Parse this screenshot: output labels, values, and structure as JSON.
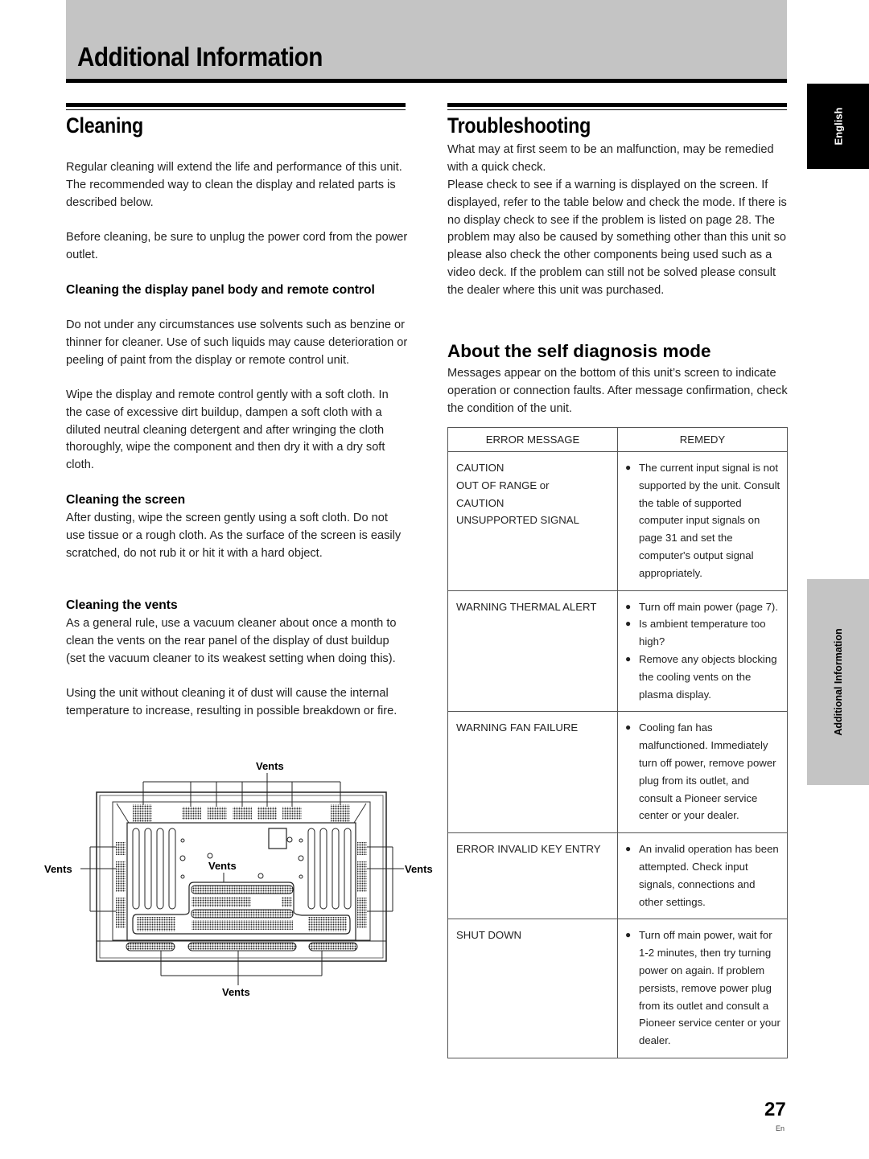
{
  "header": {
    "title": "Additional Information"
  },
  "side_tabs": {
    "language": "English",
    "section": "Additional Information"
  },
  "cleaning": {
    "title": "Cleaning",
    "intro": "Regular cleaning will extend the life and performance of this unit. The recommended way to clean the display and related parts is described below.",
    "unplug_note": "Before cleaning, be sure to unplug the power cord from the power outlet.",
    "panel": {
      "heading": "Cleaning the display panel body and remote control",
      "p1": "Do not under any circumstances use solvents such as benzine or thinner for cleaner. Use of such liquids may cause deterioration or peeling of paint from the display or remote control unit.",
      "p2": "Wipe the display and remote control gently with a soft cloth. In the case of excessive dirt buildup, dampen a soft cloth with a diluted neutral cleaning detergent and after wringing the cloth thoroughly, wipe the component and then dry it with a dry soft cloth."
    },
    "screen": {
      "heading": "Cleaning the screen",
      "p1": "After dusting, wipe the screen gently using a soft cloth. Do not use tissue or a rough cloth. As the surface of the screen is easily scratched, do not rub it or hit it with a hard object."
    },
    "vents": {
      "heading": "Cleaning the vents",
      "p1": "As a general rule, use a vacuum cleaner about once a month to clean the vents on the rear panel of the display of dust buildup (set the vacuum cleaner to its weakest setting when doing this).",
      "p2": "Using the unit without cleaning it of dust will cause the internal temperature to increase, resulting in possible breakdown or fire."
    },
    "diagram_labels": {
      "top": "Vents",
      "left": "Vents",
      "right": "Vents",
      "center": "Vents",
      "bottom": "Vents"
    }
  },
  "troubleshooting": {
    "title": "Troubleshooting",
    "p1": "What may at first seem to be an malfunction, may be remedied with a quick check.",
    "p2": "Please check to see if a warning is displayed on the screen. If displayed, refer to the table below and check the mode. If there is no display check to see if the problem is listed on page 28. The problem may also be caused by something other than this unit so please also check the other components being used such as a video deck. If the problem can still not be solved please consult the dealer where this unit was purchased."
  },
  "self_diagnosis": {
    "title": "About the self diagnosis mode",
    "p1": "Messages appear on the bottom of this unit’s screen to indicate operation or connection faults. After message confirmation, check the condition of the unit.",
    "table": {
      "headers": [
        "ERROR MESSAGE",
        "REMEDY"
      ],
      "rows": [
        {
          "message": [
            "CAUTION",
            "OUT OF RANGE or",
            "CAUTION",
            "UNSUPPORTED SIGNAL"
          ],
          "remedy": [
            "The current input signal is not supported by the unit. Consult the table of supported computer input signals on page 31 and set the computer's output signal appropriately."
          ]
        },
        {
          "message": [
            "WARNING THERMAL ALERT"
          ],
          "remedy": [
            "Turn off main power (page 7).",
            "Is ambient temperature too high?",
            "Remove any objects blocking the cooling vents on the plasma display."
          ]
        },
        {
          "message": [
            "WARNING FAN FAILURE"
          ],
          "remedy": [
            "Cooling fan has malfunctioned. Immediately turn off power, remove power plug from its outlet, and consult a Pioneer service center or your dealer."
          ]
        },
        {
          "message": [
            "ERROR INVALID KEY ENTRY"
          ],
          "remedy": [
            "An invalid operation has been attempted. Check input signals, connections and other settings."
          ]
        },
        {
          "message": [
            "SHUT DOWN"
          ],
          "remedy": [
            "Turn off main power, wait for 1-2 minutes, then try turning power on again. If problem persists, remove power plug from its outlet and consult a Pioneer service center or your dealer."
          ]
        }
      ]
    }
  },
  "footer": {
    "page_number": "27",
    "language_code": "En"
  }
}
